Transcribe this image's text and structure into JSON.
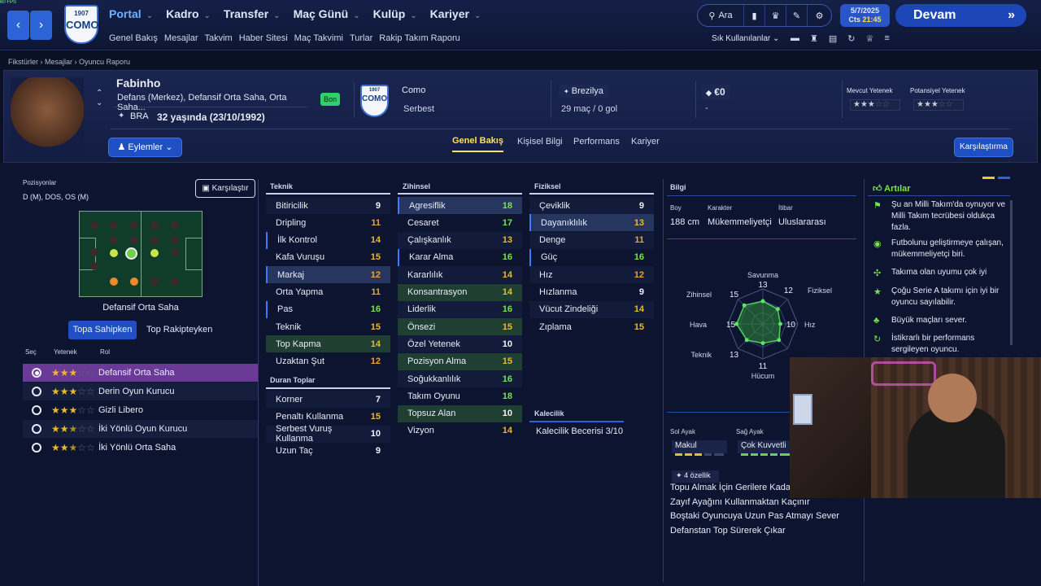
{
  "fps": "60 FPS",
  "nav": {
    "back": "‹",
    "forward": "›",
    "crest_year": "1907",
    "crest_name": "COMO",
    "menu": [
      {
        "label": "Portal",
        "active": true
      },
      {
        "label": "Kadro"
      },
      {
        "label": "Transfer"
      },
      {
        "label": "Maç Günü"
      },
      {
        "label": "Kulüp"
      },
      {
        "label": "Kariyer"
      }
    ],
    "submenu": [
      "Genel Bakış",
      "Mesajlar",
      "Takvim",
      "Haber Sitesi",
      "Maç Takvimi",
      "Turlar",
      "Rakip Takım Raporu"
    ],
    "search_label": "Ara",
    "date": "5/7/2025",
    "time_day": "Cts",
    "time": "21:45",
    "continue_label": "Devam",
    "quick_label": "Sık Kullanılanlar"
  },
  "breadcrumb": [
    "Fikstürler",
    "Mesajlar",
    "Oyuncu Raporu"
  ],
  "player": {
    "name": "Fabinho",
    "positions_text": "Defans (Merkez), Defansif Orta Saha, Orta Saha...",
    "status_badge": "Bon",
    "nation_code": "BRA",
    "age_text": "32 yaşında (23/10/1992)",
    "club": "Como",
    "club_status": "Serbest",
    "nation": "Brezilya",
    "caps": "29 maç / 0 gol",
    "value": "€0",
    "value_sub": "-",
    "current_ability_label": "Mevcut Yetenek",
    "potential_ability_label": "Potansiyel Yetenek",
    "current_stars": 3,
    "potential_stars": 3,
    "actions_label": "Eylemler",
    "compare_label": "Karşılaştırma"
  },
  "tabs": [
    "Genel Bakış",
    "Kişisel Bilgi",
    "Performans",
    "Kariyer"
  ],
  "positions": {
    "title": "Pozisyonlar",
    "value": "D (M), DOS, OS (M)",
    "compare": "Karşılaştır",
    "selected_role": "Defansif Orta Saha",
    "mode_tabs": [
      "Topa Sahipken",
      "Top Rakipteyken"
    ],
    "headers": [
      "Seç",
      "Yetenek",
      "Rol"
    ],
    "roles": [
      {
        "name": "Defansif Orta Saha",
        "stars": 3,
        "selected": true
      },
      {
        "name": "Derin Oyun Kurucu",
        "stars": 3
      },
      {
        "name": "Gizli Libero",
        "stars": 3
      },
      {
        "name": "İki Yönlü Oyun Kurucu",
        "stars": 2.5
      },
      {
        "name": "İki Yönlü Orta Saha",
        "stars": 2.5
      }
    ]
  },
  "attributes": {
    "teknik_title": "Teknik",
    "teknik": [
      {
        "name": "Bitiricilik",
        "value": "9"
      },
      {
        "name": "Dripling",
        "value": "11"
      },
      {
        "name": "İlk Kontrol",
        "value": "14"
      },
      {
        "name": "Kafa Vuruşu",
        "value": "15"
      },
      {
        "name": "Markaj",
        "value": "12"
      },
      {
        "name": "Orta Yapma",
        "value": "11"
      },
      {
        "name": "Pas",
        "value": "16"
      },
      {
        "name": "Teknik",
        "value": "15"
      },
      {
        "name": "Top Kapma",
        "value": "14"
      },
      {
        "name": "Uzaktan Şut",
        "value": "12"
      }
    ],
    "duran_title": "Duran Toplar",
    "duran": [
      {
        "name": "Korner",
        "value": "7"
      },
      {
        "name": "Penaltı Kullanma",
        "value": "15"
      },
      {
        "name": "Serbest Vuruş Kullanma",
        "value": "10"
      },
      {
        "name": "Uzun Taç",
        "value": "9"
      }
    ],
    "zihinsel_title": "Zihinsel",
    "zihinsel": [
      {
        "name": "Agresiflik",
        "value": "18"
      },
      {
        "name": "Cesaret",
        "value": "17"
      },
      {
        "name": "Çalışkanlık",
        "value": "13"
      },
      {
        "name": "Karar Alma",
        "value": "16"
      },
      {
        "name": "Kararlılık",
        "value": "14"
      },
      {
        "name": "Konsantrasyon",
        "value": "14"
      },
      {
        "name": "Liderlik",
        "value": "16"
      },
      {
        "name": "Önsezi",
        "value": "15"
      },
      {
        "name": "Özel Yetenek",
        "value": "10"
      },
      {
        "name": "Pozisyon Alma",
        "value": "15"
      },
      {
        "name": "Soğukkanlılık",
        "value": "16"
      },
      {
        "name": "Takım Oyunu",
        "value": "18"
      },
      {
        "name": "Topsuz Alan",
        "value": "10"
      },
      {
        "name": "Vizyon",
        "value": "14"
      }
    ],
    "fiziksel_title": "Fiziksel",
    "fiziksel": [
      {
        "name": "Çeviklik",
        "value": "9"
      },
      {
        "name": "Dayanıklılık",
        "value": "13"
      },
      {
        "name": "Denge",
        "value": "11"
      },
      {
        "name": "Güç",
        "value": "16"
      },
      {
        "name": "Hız",
        "value": "12"
      },
      {
        "name": "Hızlanma",
        "value": "9"
      },
      {
        "name": "Vücut Zindeliği",
        "value": "14"
      },
      {
        "name": "Zıplama",
        "value": "15"
      }
    ],
    "kalecilik_title": "Kalecilik",
    "kalecilik_text": "Kalecilik Becerisi 3/10"
  },
  "info": {
    "title": "Bilgi",
    "height_label": "Boy",
    "height": "188 cm",
    "character_label": "Karakter",
    "character": "Mükemmeliyetçi",
    "reputation_label": "İtibar",
    "reputation": "Uluslararası",
    "left_foot_label": "Sol Ayak",
    "left_foot": "Makul",
    "right_foot_label": "Sağ Ayak",
    "right_foot": "Çok Kuvvetli",
    "traits_count": "4 özellik",
    "traits": [
      "Topu Almak İçin Gerilere Kadar G",
      "Zayıf Ayağını Kullanmaktan Kaçınır",
      "Boştaki Oyuncuya Uzun Pas Atmayı Sever",
      "Defanstan Top Sürerek Çıkar"
    ]
  },
  "radar": {
    "axes": [
      {
        "label": "Savunma",
        "value": "13"
      },
      {
        "label": "Fiziksel",
        "value": "12"
      },
      {
        "label": "Hız",
        "value": "10"
      },
      {
        "label": "",
        "value": ""
      },
      {
        "label": "Hücum",
        "value": "11"
      },
      {
        "label": "Teknik",
        "value": "13"
      },
      {
        "label": "Hava",
        "value": "15"
      },
      {
        "label": "Zihinsel",
        "value": "15"
      }
    ]
  },
  "pros": {
    "title": "Artılar",
    "items": [
      "Şu an Milli Takım'da oynuyor ve Milli Takım tecrübesi oldukça fazla.",
      "Futbolunu geliştirmeye çalışan, mükemmeliyetçi biri.",
      "Takıma olan uyumu çok iyi",
      "Çoğu Serie A takımı için iyi bir oyuncu sayılabilir.",
      "Büyük maçları sever.",
      "İstikrarlı bir performans sergileyen oyuncu."
    ]
  },
  "colors": {
    "accent": "#2c63d6",
    "selected_role": "#6a3a96",
    "yellow_tab": "#ffe15a"
  }
}
